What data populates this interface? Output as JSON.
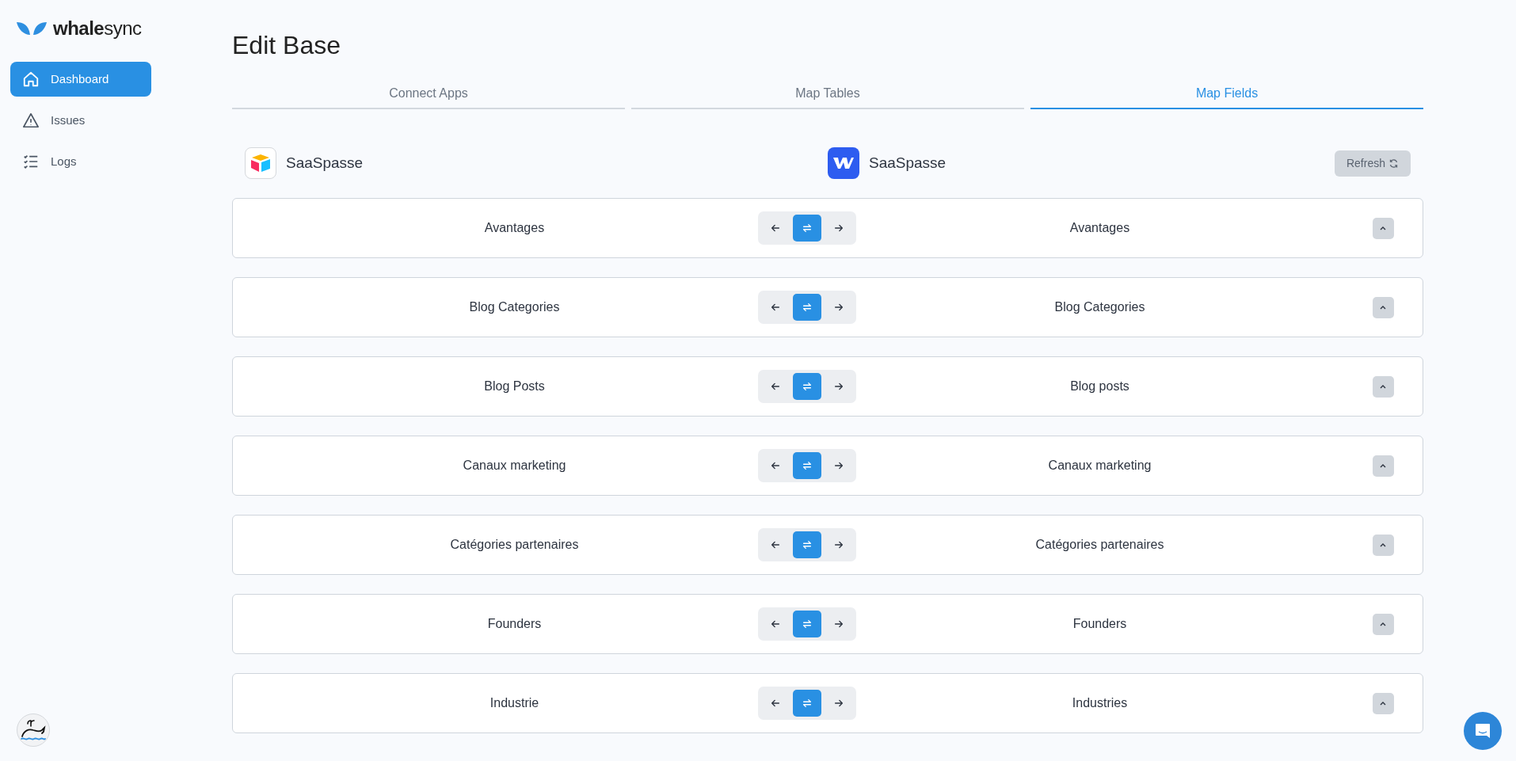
{
  "sidebar": {
    "logo": {
      "bold": "whale",
      "light": "sync"
    },
    "items": [
      {
        "label": "Dashboard",
        "selected": true
      },
      {
        "label": "Issues",
        "selected": false
      },
      {
        "label": "Logs",
        "selected": false
      }
    ]
  },
  "page": {
    "title": "Edit Base"
  },
  "tabs": [
    {
      "label": "Connect Apps",
      "selected": false
    },
    {
      "label": "Map Tables",
      "selected": false
    },
    {
      "label": "Map Fields",
      "selected": true
    }
  ],
  "apps": {
    "left": {
      "name": "SaaSpasse",
      "kind": "airtable"
    },
    "right": {
      "name": "SaaSpasse",
      "kind": "webflow"
    },
    "refresh_button": "Refresh"
  },
  "mappings": [
    {
      "left": "Avantages",
      "right": "Avantages",
      "directions": [
        {
          "selected": false
        },
        {
          "selected": true
        },
        {
          "selected": false
        }
      ]
    },
    {
      "left": "Blog Categories",
      "right": "Blog Categories",
      "directions": [
        {
          "selected": false
        },
        {
          "selected": true
        },
        {
          "selected": false
        }
      ]
    },
    {
      "left": "Blog Posts",
      "right": "Blog posts",
      "directions": [
        {
          "selected": false
        },
        {
          "selected": true
        },
        {
          "selected": false
        }
      ]
    },
    {
      "left": "Canaux marketing",
      "right": "Canaux marketing",
      "directions": [
        {
          "selected": false
        },
        {
          "selected": true
        },
        {
          "selected": false
        }
      ]
    },
    {
      "left": "Catégories partenaires",
      "right": "Catégories partenaires",
      "directions": [
        {
          "selected": false
        },
        {
          "selected": true
        },
        {
          "selected": false
        }
      ]
    },
    {
      "left": "Founders",
      "right": "Founders",
      "directions": [
        {
          "selected": false
        },
        {
          "selected": true
        },
        {
          "selected": false
        }
      ]
    },
    {
      "left": "Industrie",
      "right": "Industries",
      "directions": [
        {
          "selected": false
        },
        {
          "selected": true
        },
        {
          "selected": false
        }
      ]
    }
  ]
}
